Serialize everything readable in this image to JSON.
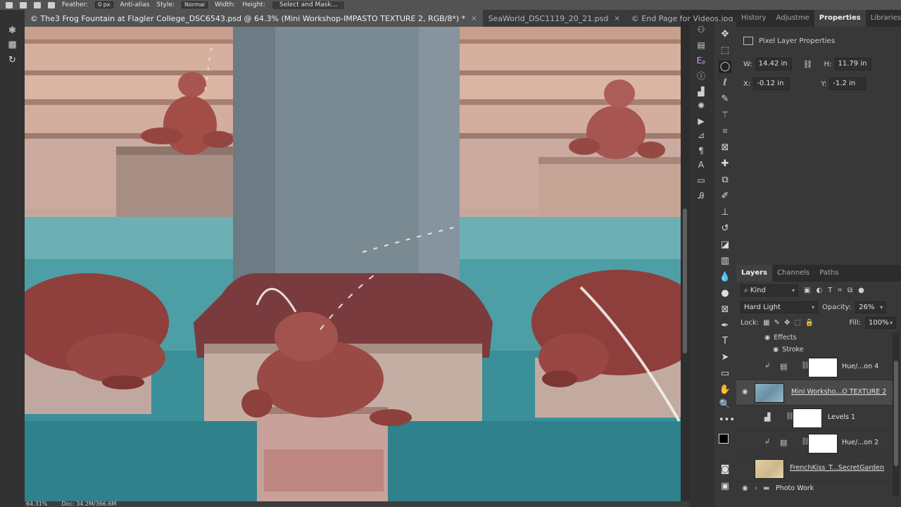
{
  "options_bar": {
    "feather_label": "Feather:",
    "feather_value": "0 px",
    "antialias_label": "Anti-alias",
    "style_label": "Style:",
    "style_value": "Normal",
    "width_label": "Width:",
    "height_label": "Height:",
    "select_mask_label": "Select and Mask..."
  },
  "tabs": [
    {
      "label": "© The3 Frog Fountain at Flagler College_DSC6543.psd @ 64.3% (Mini Workshop-IMPASTO TEXTURE 2, RGB/8*) *",
      "close": "×"
    },
    {
      "label": "SeaWorld_DSC1119_20_21.psd",
      "close": "×"
    },
    {
      "label": "© End Page for Videos.jpg @ ...",
      "close": "×"
    }
  ],
  "status": {
    "zoom": "64.31%",
    "doc": "Doc: 34.2M/366.6M"
  },
  "properties": {
    "tabs": [
      "History",
      "Adjustme",
      "Properties",
      "Libraries"
    ],
    "active_tab": "Properties",
    "header": "Pixel Layer Properties",
    "w_label": "W:",
    "w_value": "14.42 in",
    "h_label": "H:",
    "h_value": "11.79 in",
    "x_label": "X:",
    "x_value": "-0.12 in",
    "y_label": "Y:",
    "y_value": "-1.2 in"
  },
  "layers_panel": {
    "tabs": [
      "Layers",
      "Channels",
      "Paths"
    ],
    "active_tab": "Layers",
    "filter_kind": "Kind",
    "blend_mode": "Hard Light",
    "opacity_label": "Opacity:",
    "opacity_value": "26%",
    "lock_label": "Lock:",
    "fill_label": "Fill:",
    "fill_value": "100%",
    "effects_label": "Effects",
    "stroke_label": "Stroke",
    "layers": [
      {
        "name": "Hue/...on 4",
        "kind": "adjustment"
      },
      {
        "name": "Mini Worksho...O TEXTURE 2",
        "kind": "pixel",
        "selected": true
      },
      {
        "name": "Levels 1",
        "kind": "adjustment"
      },
      {
        "name": "Hue/...on 2",
        "kind": "adjustment"
      },
      {
        "name": "FrenchKiss_T...SecretGarden",
        "kind": "pixel"
      },
      {
        "name": "Photo Work",
        "kind": "group"
      }
    ]
  },
  "colors": {
    "accent": "#4a4a4a",
    "panel_bg": "#383838",
    "canvas_water": "#3d8f99",
    "frog": "#9a4a45"
  }
}
